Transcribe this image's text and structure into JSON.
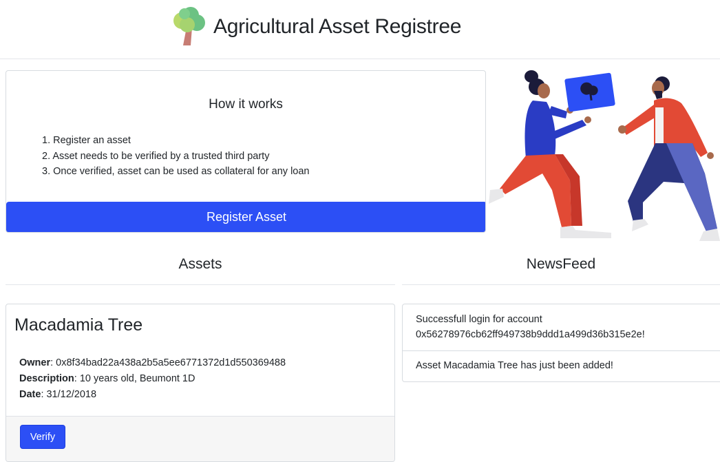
{
  "header": {
    "logo_icon": "tree-icon",
    "title": "Agricultural Asset Registree"
  },
  "how_it_works": {
    "title": "How it works",
    "steps": [
      "1. Register an asset",
      "2. Asset needs to be verified by a trusted third party",
      "3. Once verified, asset can be used as collateral for any loan"
    ],
    "register_button": "Register Asset"
  },
  "hero": {
    "illustration": "people-exchanging-tree-illustration"
  },
  "assets": {
    "title": "Assets",
    "items": [
      {
        "name": "Macadamia Tree",
        "owner_label": "Owner",
        "owner": ": 0x8f34bad22a438a2b5a5ee6771372d1d550369488",
        "description_label": "Description",
        "description": ": 10 years old, Beumont 1D",
        "date_label": "Date",
        "date": ": 31/12/2018",
        "verify_button": "Verify"
      }
    ]
  },
  "newsfeed": {
    "title": "NewsFeed",
    "items": [
      {
        "line1": "Successfull login for account",
        "line2": "0x56278976cb62ff949738b9ddd1a499d36b315e2e!"
      },
      {
        "line1": "Asset Macadamia Tree has just been added!"
      }
    ]
  },
  "colors": {
    "primary": "#2c4ff5",
    "border": "#d7dbe0",
    "footer_bg": "#f6f6f6",
    "text": "#212529"
  }
}
